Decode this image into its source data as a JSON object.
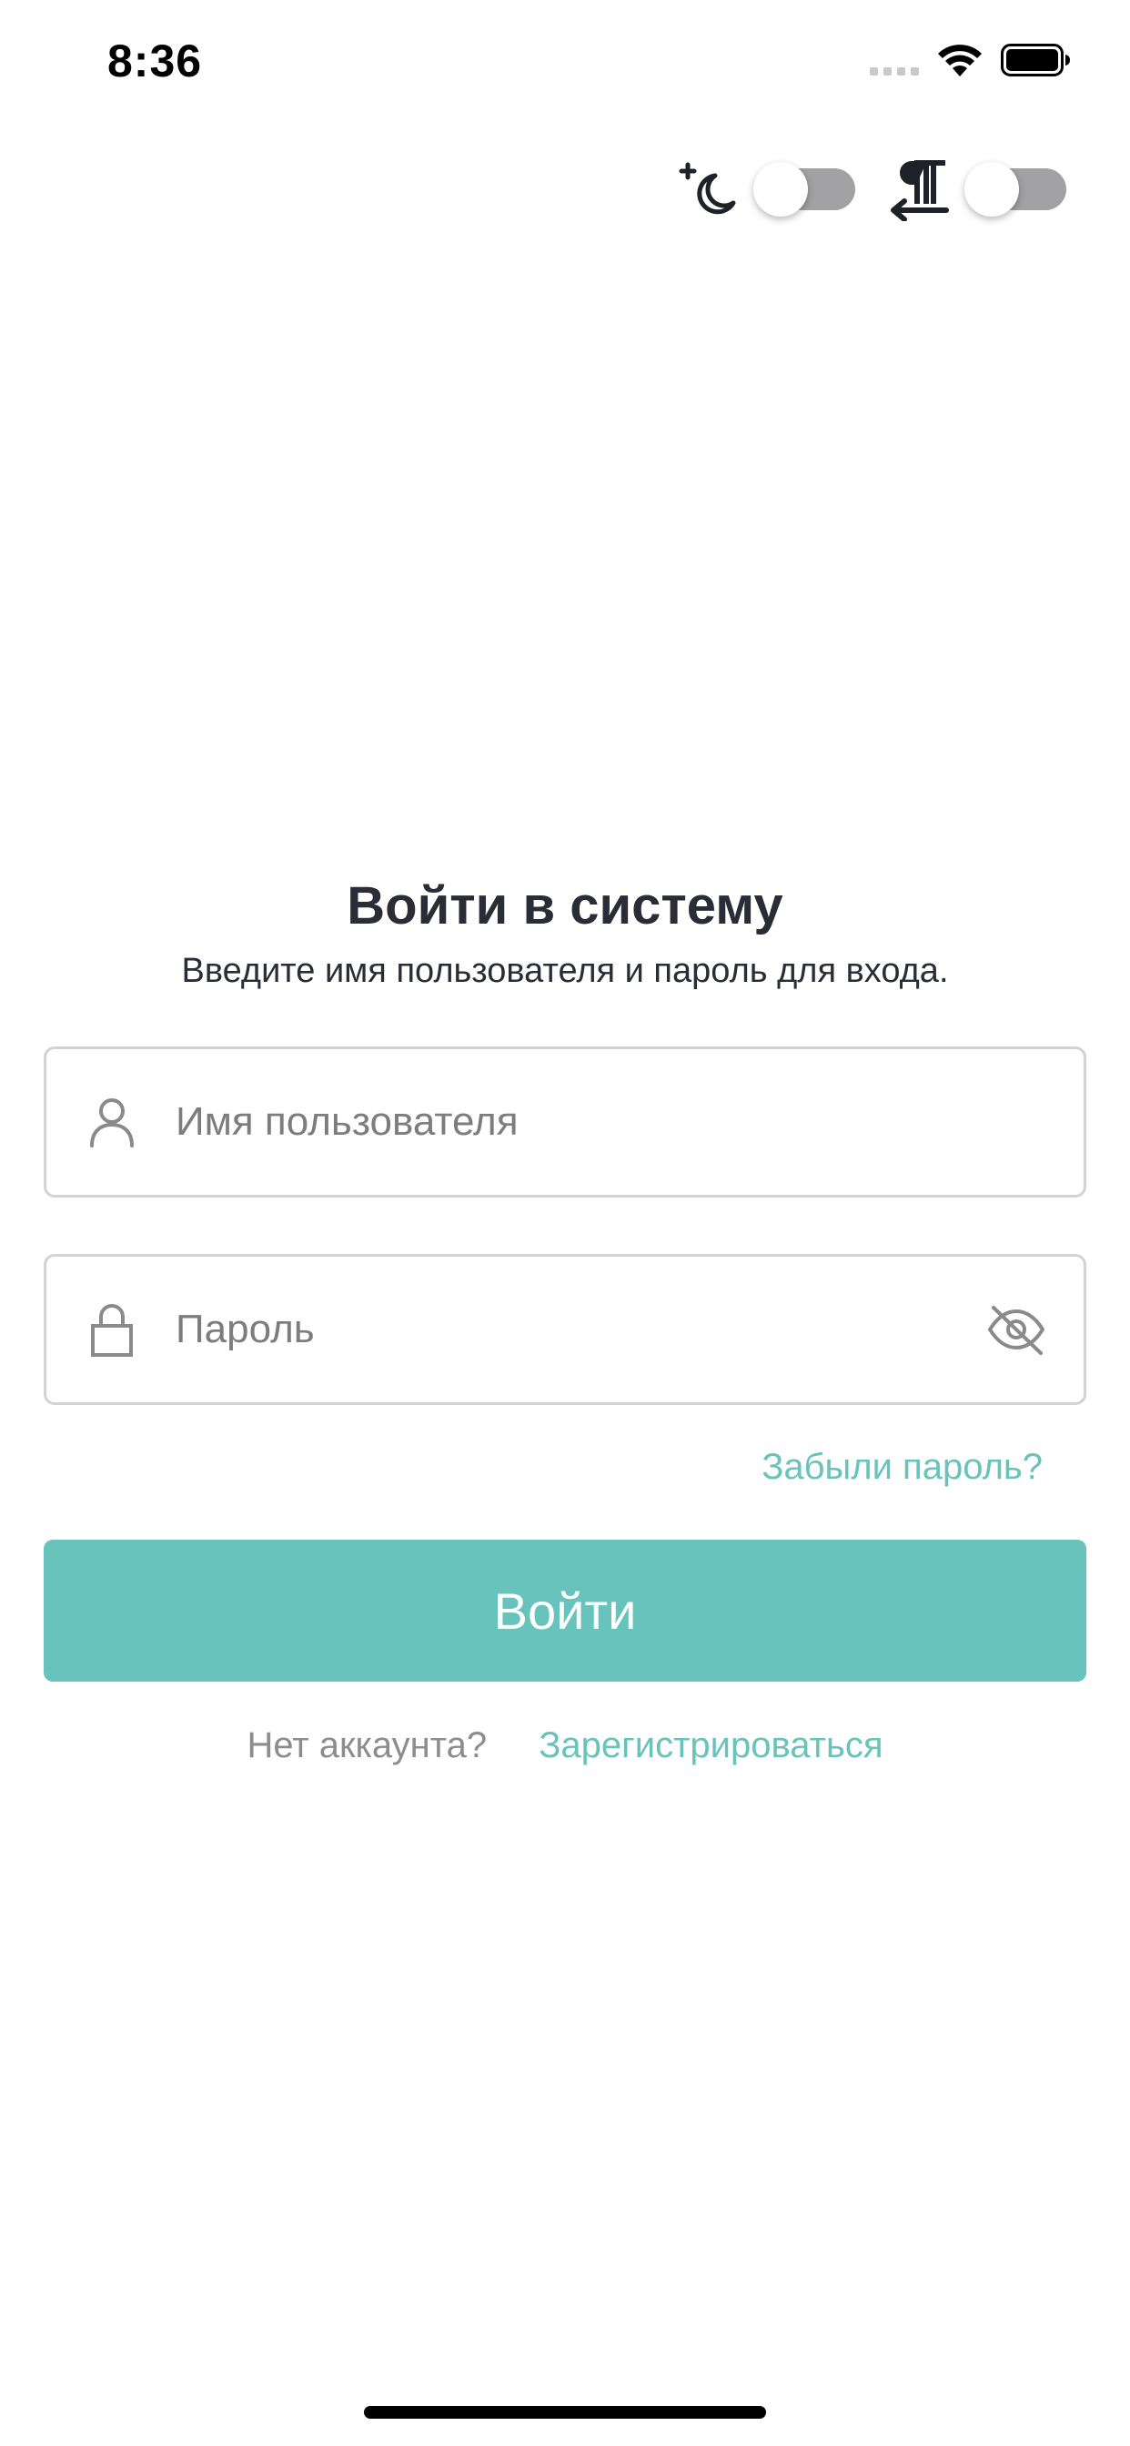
{
  "status_bar": {
    "time": "8:36"
  },
  "top_controls": {
    "dark_mode_toggle": {
      "icon": "moon-icon",
      "enabled": false
    },
    "rtl_toggle": {
      "icon": "paragraph-direction-icon",
      "enabled": false
    }
  },
  "login": {
    "title": "Войти в систему",
    "subtitle": "Введите имя пользователя и пароль для входа.",
    "username_field": {
      "icon": "user-icon",
      "placeholder": "Имя пользователя",
      "value": ""
    },
    "password_field": {
      "icon": "lock-icon",
      "placeholder": "Пароль",
      "value": "",
      "visibility_icon": "eye-off-icon"
    },
    "forgot_password": "Забыли пароль?",
    "submit_label": "Войти",
    "no_account_text": "Нет аккаунта?",
    "register_link": "Зарегистрироваться"
  },
  "colors": {
    "accent": "#68c3bc",
    "text_primary": "#2a2d36",
    "text_muted": "#8d8d8d",
    "field_border": "#d3d3d3",
    "toggle_off": "#a2a2a4"
  }
}
